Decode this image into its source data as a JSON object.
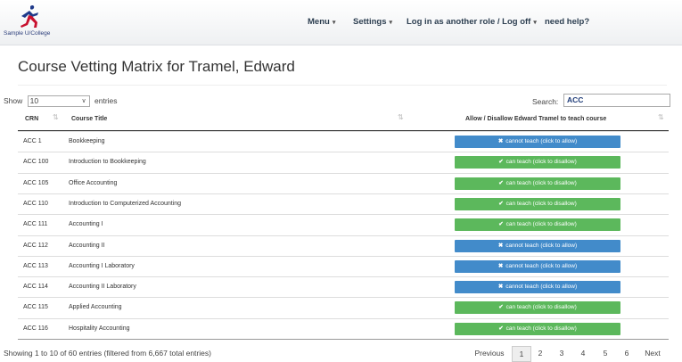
{
  "nav": {
    "logo_text": "Sample U/College",
    "menu": "Menu",
    "settings": "Settings",
    "login": "Log in as another role / Log off",
    "help": "need help?",
    "caret": "▾"
  },
  "page": {
    "title": "Course Vetting Matrix for Tramel, Edward"
  },
  "controls": {
    "show_label": "Show",
    "show_value": "10",
    "entries_label": "entries",
    "search_label": "Search:",
    "search_value": "ACC"
  },
  "table": {
    "headers": {
      "crn": "CRN",
      "title": "Course Title",
      "action": "Allow / Disallow Edward Tramel to teach course"
    },
    "rows": [
      {
        "crn": "ACC 1",
        "title": "Bookkeeping",
        "status": "cannot teach (click to allow)",
        "icon": "✖"
      },
      {
        "crn": "ACC 100",
        "title": "Introduction to Bookkeeping",
        "status": "can teach (click to disallow)",
        "icon": "✔"
      },
      {
        "crn": "ACC 105",
        "title": "Office Accounting",
        "status": "can teach (click to disallow)",
        "icon": "✔"
      },
      {
        "crn": "ACC 110",
        "title": "Introduction to Computerized Accounting",
        "status": "can teach (click to disallow)",
        "icon": "✔"
      },
      {
        "crn": "ACC 111",
        "title": "Accounting I",
        "status": "can teach (click to disallow)",
        "icon": "✔"
      },
      {
        "crn": "ACC 112",
        "title": "Accounting II",
        "status": "cannot teach (click to allow)",
        "icon": "✖"
      },
      {
        "crn": "ACC 113",
        "title": "Accounting I Laboratory",
        "status": "cannot teach (click to allow)",
        "icon": "✖"
      },
      {
        "crn": "ACC 114",
        "title": "Accounting II Laboratory",
        "status": "cannot teach (click to allow)",
        "icon": "✖"
      },
      {
        "crn": "ACC 115",
        "title": "Applied Accounting",
        "status": "can teach (click to disallow)",
        "icon": "✔"
      },
      {
        "crn": "ACC 116",
        "title": "Hospitality Accounting",
        "status": "can teach (click to disallow)",
        "icon": "✔"
      }
    ]
  },
  "footer": {
    "info": "Showing 1 to 10 of 60 entries (filtered from 6,667 total entries)",
    "previous": "Previous",
    "pages": [
      "1",
      "2",
      "3",
      "4",
      "5",
      "6"
    ],
    "next": "Next"
  },
  "colors": {
    "allow": "#5cb85c",
    "deny": "#428bca",
    "nav_text": "#2c3e50"
  }
}
